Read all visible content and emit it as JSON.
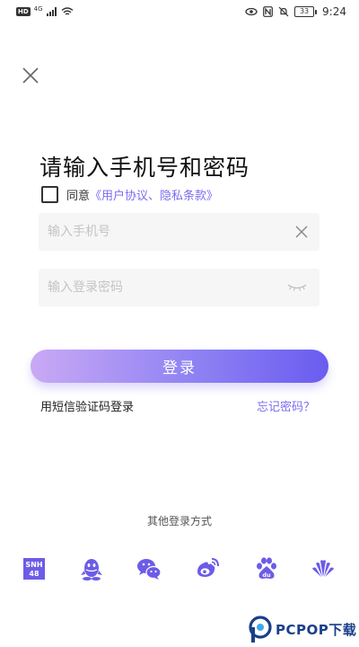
{
  "status_bar": {
    "hd_badge": "HD",
    "network": "4G",
    "battery": "33",
    "time": "9:24"
  },
  "header": {
    "title": "请输入手机号和密码"
  },
  "agreement": {
    "prefix": "同意",
    "link": "《用户协议、隐私条款》",
    "checked": false
  },
  "phone_input": {
    "placeholder": "输入手机号",
    "value": ""
  },
  "password_input": {
    "placeholder": "输入登录密码",
    "value": ""
  },
  "login_button": {
    "label": "登录"
  },
  "links": {
    "sms_login": "用短信验证码登录",
    "forgot_password": "忘记密码？"
  },
  "other_login": {
    "label": "其他登录方式",
    "providers": [
      {
        "id": "snh48",
        "icon": "snh48-icon"
      },
      {
        "id": "qq",
        "icon": "qq-icon"
      },
      {
        "id": "wechat",
        "icon": "wechat-icon"
      },
      {
        "id": "weibo",
        "icon": "weibo-icon"
      },
      {
        "id": "baidu",
        "icon": "baidu-icon"
      },
      {
        "id": "huawei",
        "icon": "huawei-icon"
      }
    ]
  },
  "watermark": {
    "text": "PCPOP下载"
  },
  "colors": {
    "accent": "#7b6bf0",
    "button_gradient_start": "#c9a9f5",
    "button_gradient_end": "#6a5cf0",
    "icon_color": "#6c5ce7"
  }
}
